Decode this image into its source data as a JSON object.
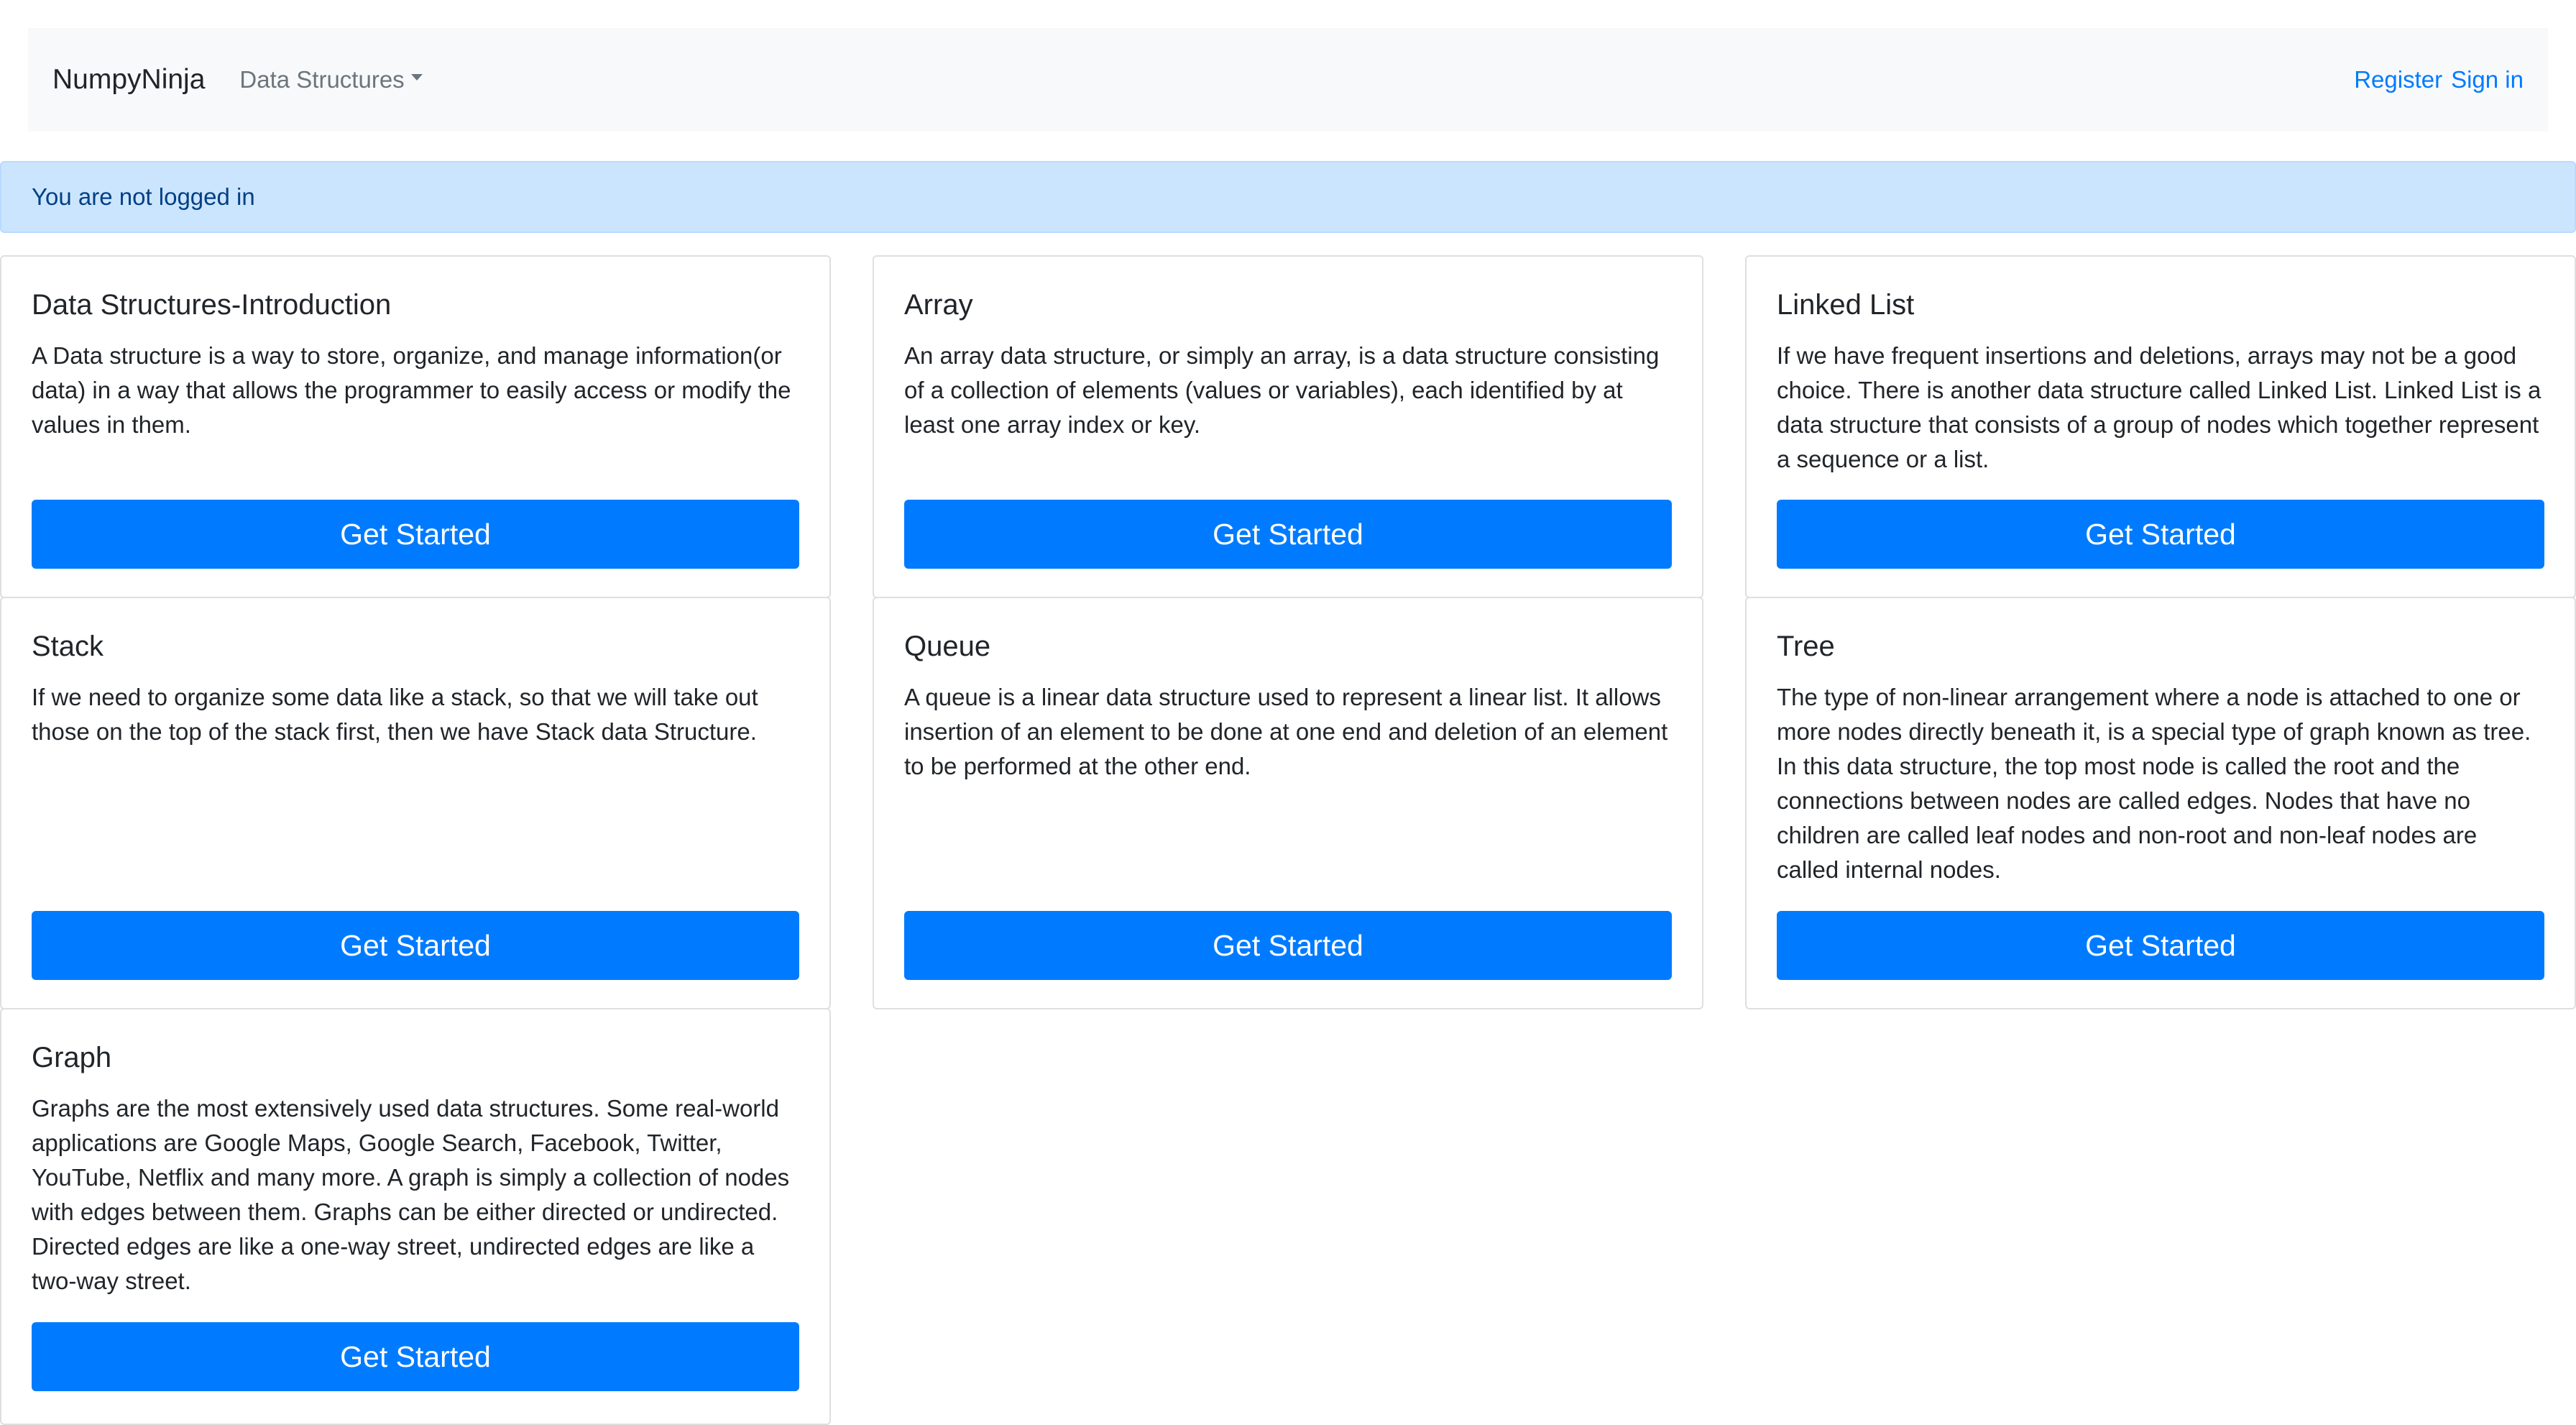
{
  "navbar": {
    "brand": "NumpyNinja",
    "dropdown_label": "Data Structures",
    "register_label": "Register",
    "signin_label": "Sign in"
  },
  "alert": {
    "text": "You are not logged in"
  },
  "cards": [
    {
      "title": "Data Structures-Introduction",
      "text": "A Data structure is a way to store, organize, and manage information(or data) in a way that allows the programmer to easily access or modify the values in them.",
      "button": "Get Started"
    },
    {
      "title": "Array",
      "text": "An array data structure, or simply an array, is a data structure consisting of a collection of elements (values or variables), each identified by at least one array index or key.",
      "button": "Get Started"
    },
    {
      "title": "Linked List",
      "text": "If we have frequent insertions and deletions, arrays may not be a good choice. There is another data structure called Linked List. Linked List is a data structure that consists of a group of nodes which together represent a sequence or a list.",
      "button": "Get Started"
    },
    {
      "title": "Stack",
      "text": "If we need to organize some data like a stack, so that we will take out those on the top of the stack first, then we have Stack data Structure.",
      "button": "Get Started"
    },
    {
      "title": "Queue",
      "text": "A queue is a linear data structure used to represent a linear list. It allows insertion of an element to be done at one end and deletion of an element to be performed at the other end.",
      "button": "Get Started"
    },
    {
      "title": "Tree",
      "text": "The type of non-linear arrangement where a node is attached to one or more nodes directly beneath it, is a special type of graph known as tree. In this data structure, the top most node is called the root and the connections between nodes are called edges. Nodes that have no children are called leaf nodes and non-root and non-leaf nodes are called internal nodes.",
      "button": "Get Started"
    },
    {
      "title": "Graph",
      "text": "Graphs are the most extensively used data structures. Some real-world applications are Google Maps, Google Search, Facebook, Twitter, YouTube, Netflix and many more. A graph is simply a collection of nodes with edges between them. Graphs can be either directed or undirected. Directed edges are like a one-way street, undirected edges are like a two-way street.",
      "button": "Get Started"
    }
  ]
}
